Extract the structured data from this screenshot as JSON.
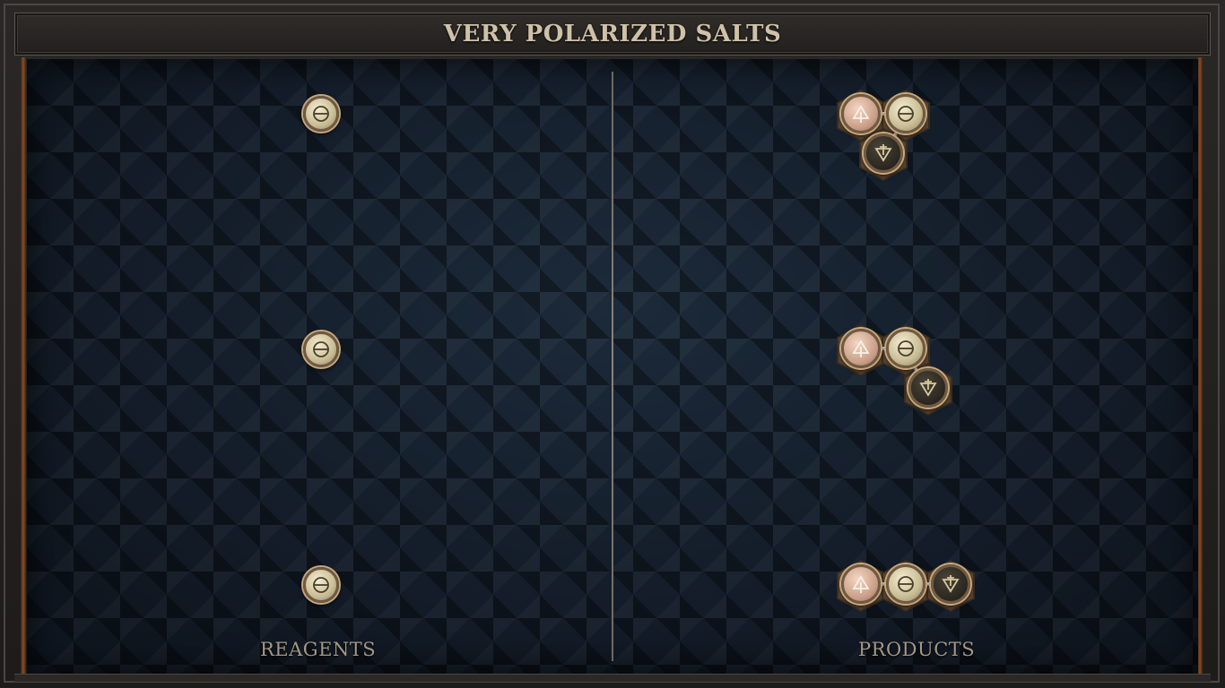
{
  "puzzle": {
    "title": "VERY POLARIZED SALTS"
  },
  "labels": {
    "reagents": "REAGENTS",
    "products": "PRODUCTS"
  },
  "reagents": [
    {
      "element": "salt"
    },
    {
      "element": "salt"
    },
    {
      "element": "salt"
    }
  ],
  "products": [
    {
      "atoms": [
        "vitae",
        "salt",
        "mors"
      ],
      "shape": "triangle"
    },
    {
      "atoms": [
        "vitae",
        "salt",
        "mors"
      ],
      "shape": "bent"
    },
    {
      "atoms": [
        "vitae",
        "salt",
        "mors"
      ],
      "shape": "linear"
    }
  ],
  "icons": {
    "salt": "salt-icon",
    "vitae": "vitae-icon",
    "mors": "mors-icon"
  }
}
